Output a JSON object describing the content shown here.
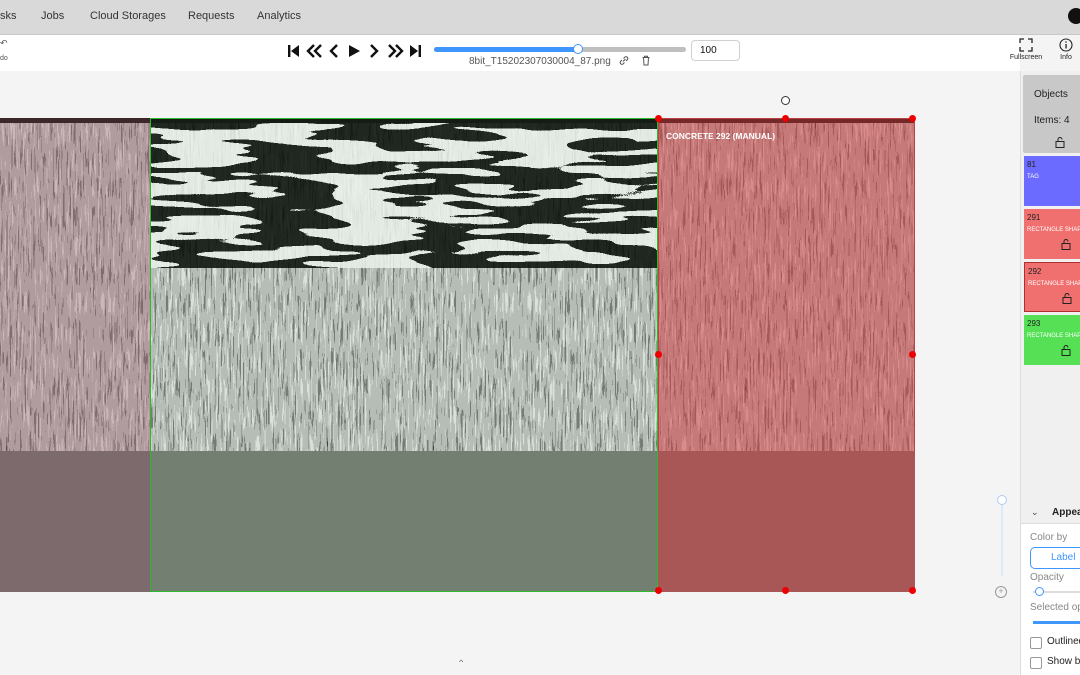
{
  "nav": {
    "items": [
      "sks",
      "Jobs",
      "Cloud Storages",
      "Requests",
      "Analytics"
    ]
  },
  "toolbar": {
    "undo_label": "do",
    "frame_number": "100",
    "filename": "8bit_T15202307030004_87.png",
    "playback_progress": 0.57,
    "fullscreen_label": "Fullscreen",
    "info_label": "Info"
  },
  "canvas": {
    "object_label": "CONCRETE 292 (MANUAL)"
  },
  "sidebar": {
    "tab_label": "Objects",
    "items_count": "Items: 4",
    "objects": [
      {
        "id": "81",
        "type": "TAG",
        "color": "#6b6bff"
      },
      {
        "id": "291",
        "type": "RECTANGLE SHAPE",
        "color": "#f07070"
      },
      {
        "id": "292",
        "type": "RECTANGLE SHAPE",
        "color": "#f07070"
      },
      {
        "id": "293",
        "type": "RECTANGLE SHAPE",
        "color": "#55e055"
      }
    ],
    "appearance": {
      "title": "Appearance",
      "color_by": "Color by",
      "label_button": "Label",
      "opacity": "Opacity",
      "opacity_value": 0.1,
      "selected_opacity": "Selected opacity",
      "outline": "Outlined borders",
      "show_bitmap": "Show bitmap"
    }
  },
  "colors": {
    "accent": "#4096ff",
    "handle": "#e00000",
    "rect_red": "#c05050",
    "rect_green": "#2eb82e"
  }
}
